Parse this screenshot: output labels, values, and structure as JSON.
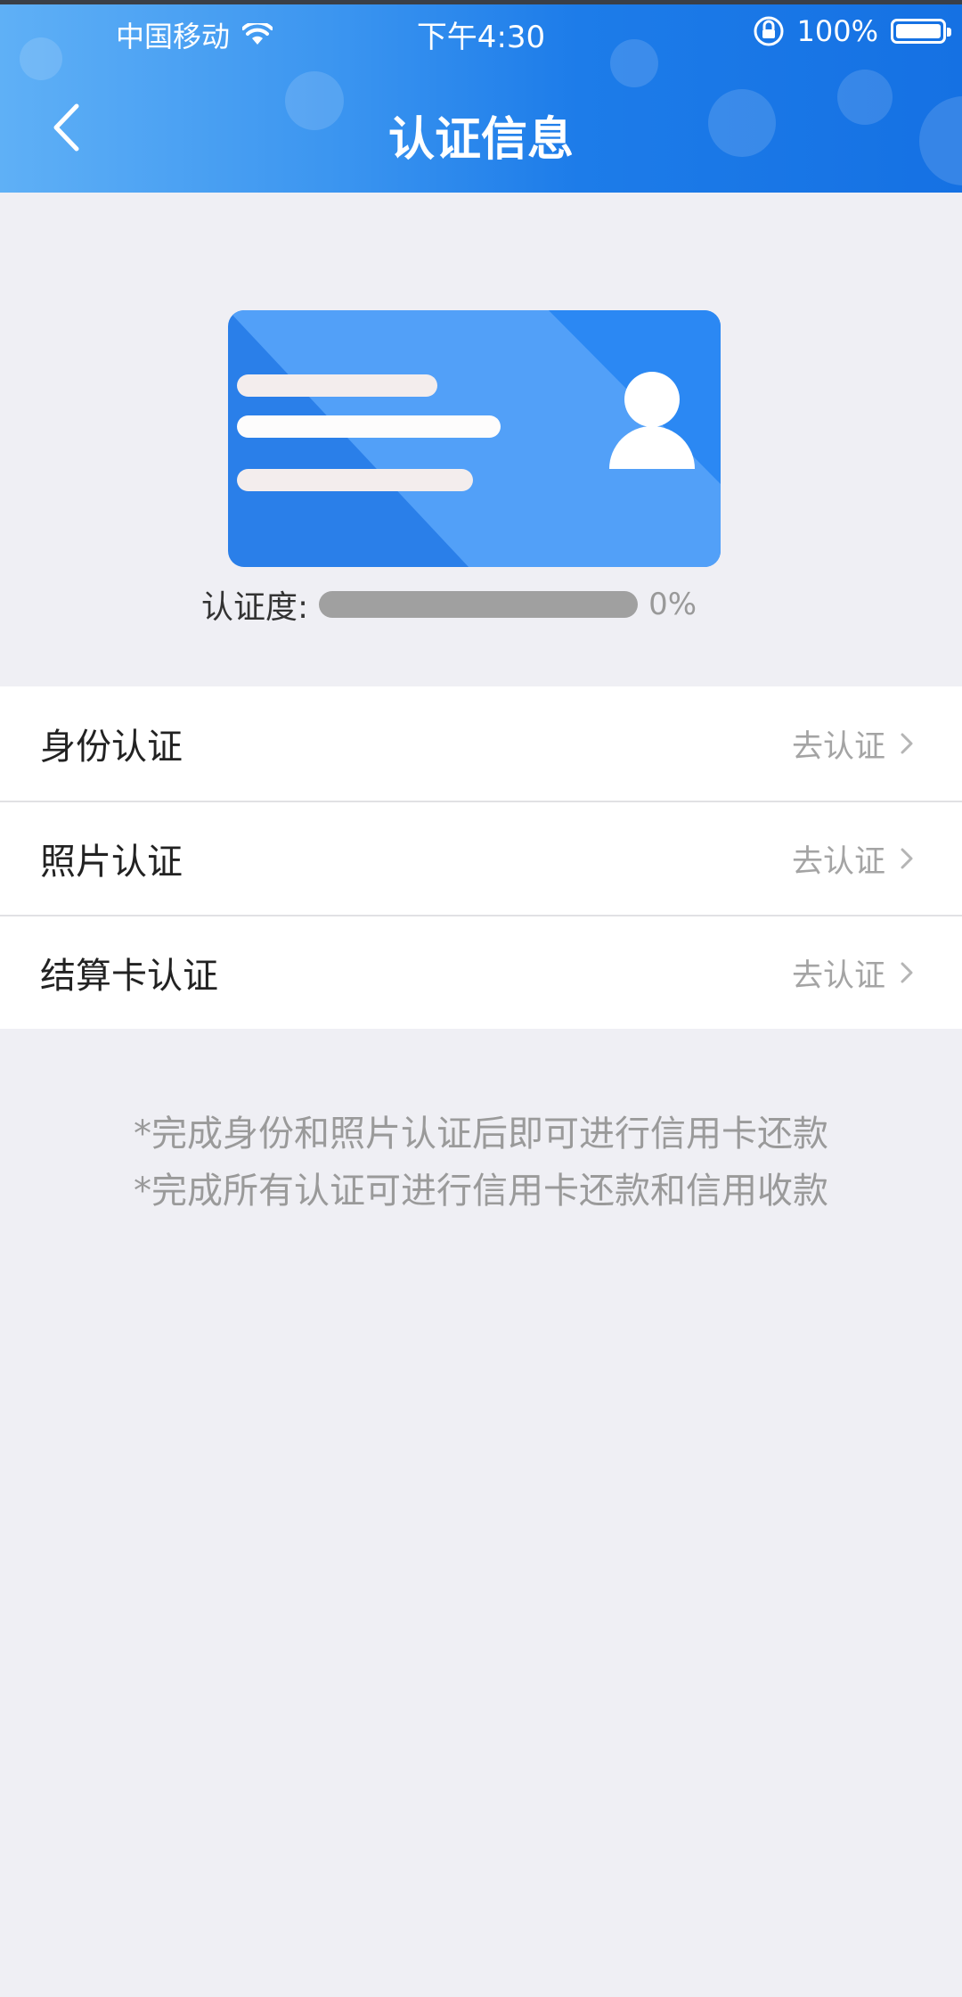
{
  "status_bar": {
    "carrier": "中国移动",
    "time": "下午4:30",
    "battery": "100%"
  },
  "header": {
    "title": "认证信息"
  },
  "progress": {
    "label": "认证度:",
    "percent_text": "0%",
    "value": 0
  },
  "list": {
    "items": [
      {
        "label": "身份认证",
        "action": "去认证"
      },
      {
        "label": "照片认证",
        "action": "去认证"
      },
      {
        "label": "结算卡认证",
        "action": "去认证"
      }
    ]
  },
  "notes": {
    "line1": "*完成身份和照片认证后即可进行信用卡还款",
    "line2": "*完成所有认证可进行信用卡还款和信用收款"
  },
  "colors": {
    "header_gradient_start": "#5fb0f6",
    "header_gradient_end": "#1571e3",
    "card_blue": "#2d86ee",
    "background": "#efeff4"
  }
}
